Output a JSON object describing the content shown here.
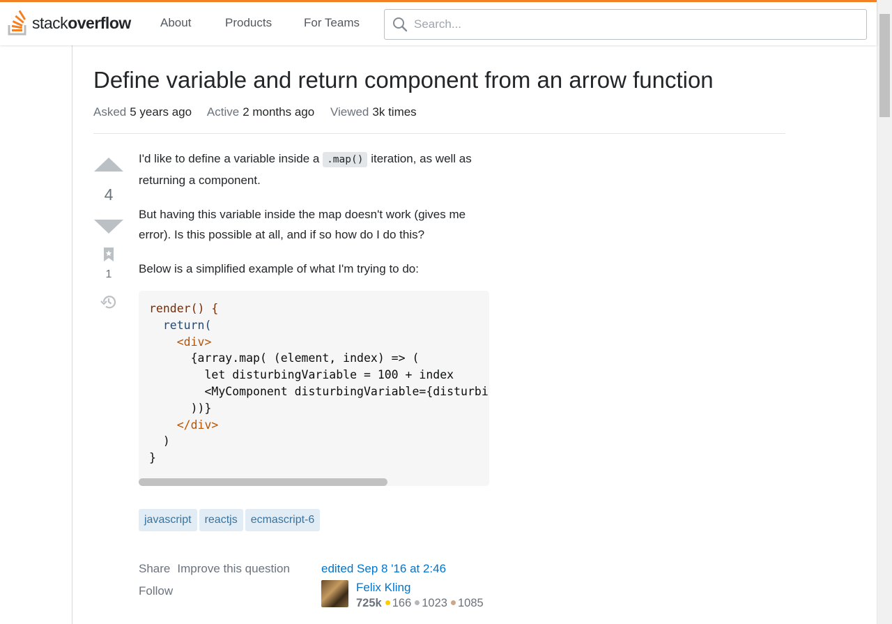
{
  "header": {
    "logo_light": "stack",
    "logo_bold": "overflow",
    "nav": [
      "About",
      "Products",
      "For Teams"
    ],
    "search_placeholder": "Search..."
  },
  "question": {
    "title": "Define variable and return component from an arrow function",
    "meta": {
      "asked_label": "Asked",
      "asked_value": "5 years ago",
      "active_label": "Active",
      "active_value": "2 months ago",
      "viewed_label": "Viewed",
      "viewed_value": "3k times"
    },
    "votes": "4",
    "bookmarks": "1",
    "body": {
      "p1_before": "I'd like to define a variable inside a ",
      "p1_code": ".map()",
      "p1_after": " iteration, as well as returning a component.",
      "p2": "But having this variable inside the map doesn't work (gives me error). Is this possible at all, and if so how do I do this?",
      "p3": "Below is a simplified example of what I'm trying to do:"
    },
    "code_lines": [
      "render() {",
      "  return(",
      "    <div>",
      "      {array.map( (element, index) => (",
      "        let disturbingVariable = 100 + index",
      "        <MyComponent disturbingVariable={disturbingVariable} />",
      "      ))}",
      "    </div>",
      "  )",
      "}"
    ],
    "tags": [
      "javascript",
      "reactjs",
      "ecmascript-6"
    ],
    "actions": {
      "share": "Share",
      "improve": "Improve this question",
      "follow": "Follow"
    },
    "editor": {
      "edited": "edited Sep 8 '16 at 2:46",
      "name": "Felix Kling",
      "reputation": "725k",
      "gold": "166",
      "silver": "1023",
      "bronze": "1085"
    }
  },
  "colors": {
    "accent": "#f48024",
    "link": "#0074cc",
    "tag_bg": "#e1ecf4",
    "tag_text": "#39739d"
  }
}
